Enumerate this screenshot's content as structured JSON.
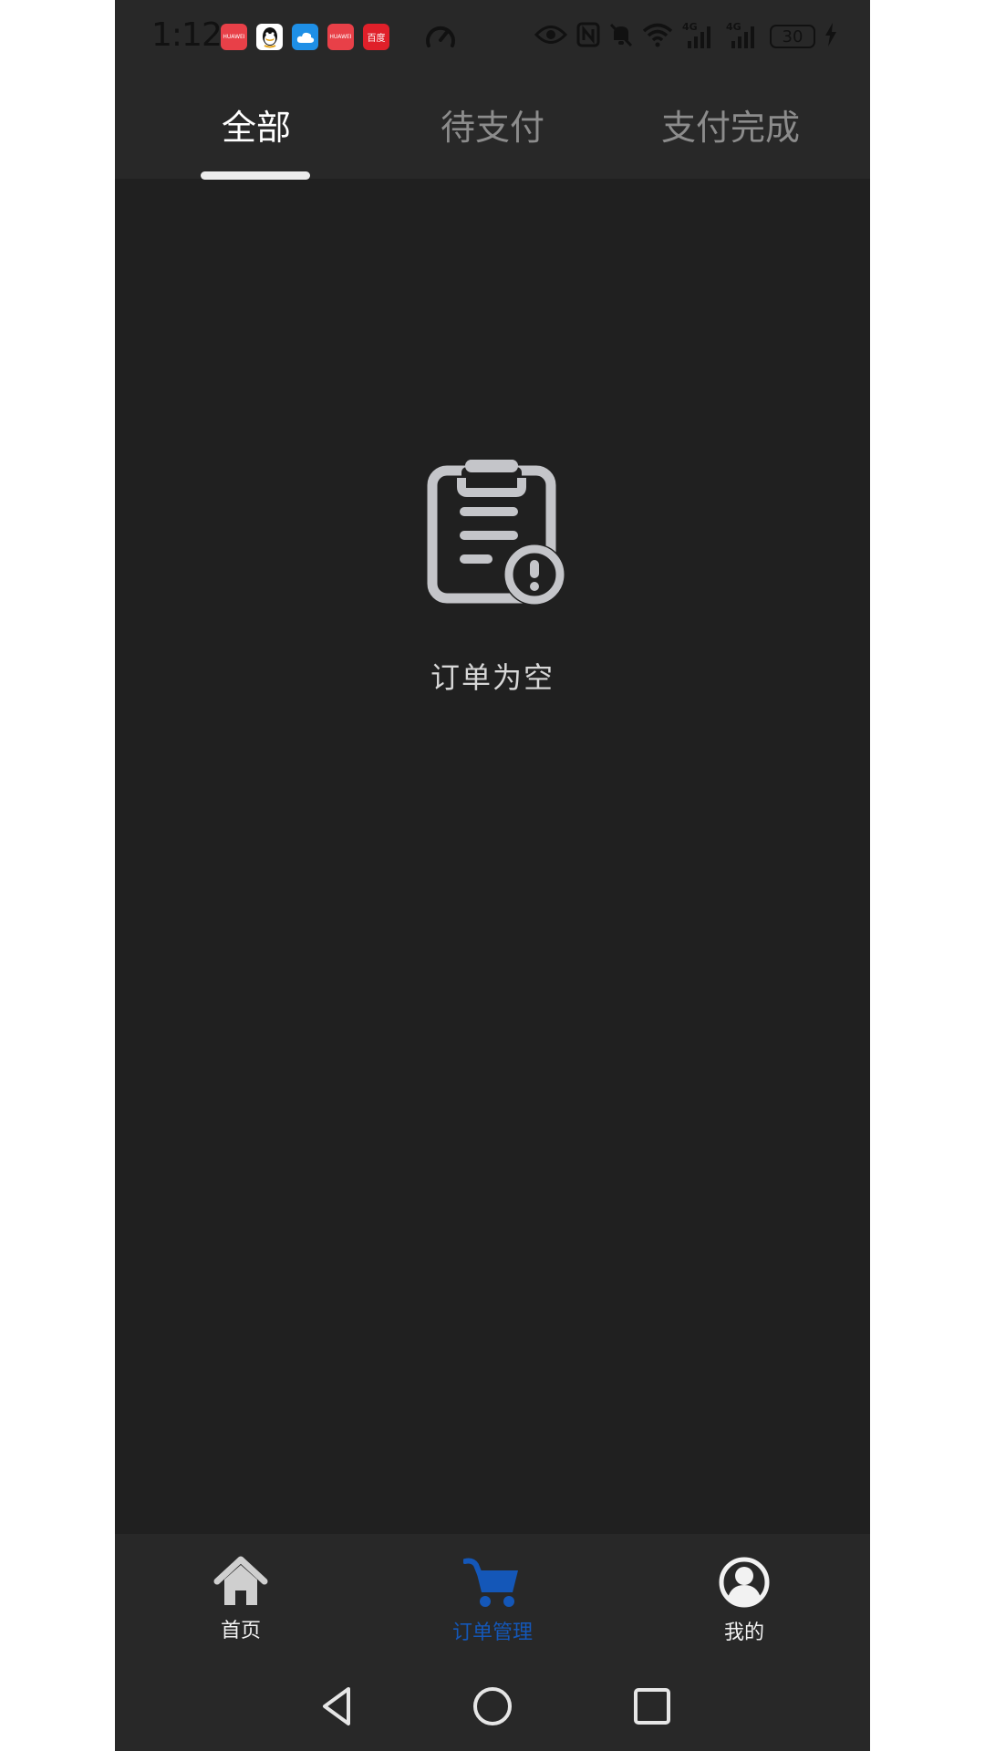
{
  "status_bar": {
    "time": "1:12",
    "battery": "30",
    "network_1": "4G",
    "network_2": "4G",
    "app_icons": [
      {
        "icon": "huawei-app-icon",
        "color": "#e84048",
        "label": "HUAWEI"
      },
      {
        "icon": "qq-icon",
        "color": "#ffffff",
        "label": ""
      },
      {
        "icon": "cloud-icon",
        "color": "#1e8fe6",
        "label": ""
      },
      {
        "icon": "huawei-app-icon",
        "color": "#e84048",
        "label": "HUAWEI"
      },
      {
        "icon": "news-app-icon",
        "color": "#e0202a",
        "label": "百度"
      }
    ]
  },
  "tabs": [
    {
      "label": "全部",
      "active": true
    },
    {
      "label": "待支付",
      "active": false
    },
    {
      "label": "支付完成",
      "active": false
    }
  ],
  "empty_state": {
    "icon": "clipboard-alert-icon",
    "message": "订单为空"
  },
  "bottom_nav": [
    {
      "label": "首页",
      "icon": "home-icon",
      "active": false
    },
    {
      "label": "订单管理",
      "icon": "cart-icon",
      "active": true
    },
    {
      "label": "我的",
      "icon": "profile-icon",
      "active": false
    }
  ],
  "colors": {
    "background": "#202020",
    "bar": "#282828",
    "accent": "#1457b8",
    "inactive_tab": "#8c8c8c",
    "icon_gray": "#c4c5c9"
  }
}
